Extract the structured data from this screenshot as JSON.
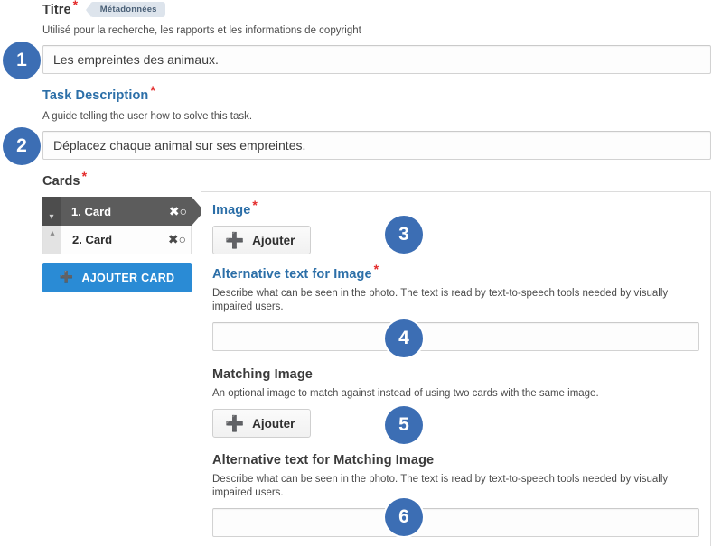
{
  "form": {
    "title_field": {
      "label": "Titre",
      "required_marker": "*",
      "metadata_tag": "Métadonnées",
      "helper": "Utilisé pour la recherche, les rapports et les informations de copyright",
      "value": "Les empreintes des animaux.",
      "placeholder": ""
    },
    "task_description_field": {
      "label": "Task Description",
      "required_marker": "*",
      "helper": "A guide telling the user how to solve this task.",
      "value": "Déplacez chaque animal sur ses empreintes.",
      "placeholder": ""
    },
    "cards_section": {
      "label": "Cards",
      "required_marker": "*",
      "items": [
        {
          "title": "1. Card",
          "remove_icon": "close-circle-icon",
          "handle_icon": "chevron-down-icon",
          "active": true
        },
        {
          "title": "2. Card",
          "remove_icon": "close-circle-icon",
          "handle_icon": "chevron-up-icon",
          "active": false
        }
      ],
      "add_button_label": "AJOUTER CARD",
      "add_button_icon": "plus-icon"
    },
    "card_editor": {
      "image": {
        "label": "Image",
        "required_marker": "*",
        "add_button_label": "Ajouter",
        "add_button_icon": "plus-icon"
      },
      "image_alt": {
        "label": "Alternative text for Image",
        "required_marker": "*",
        "helper": "Describe what can be seen in the photo. The text is read by text-to-speech tools needed by visually impaired users.",
        "value": "",
        "placeholder": ""
      },
      "matching_image": {
        "label": "Matching Image",
        "helper": "An optional image to match against instead of using two cards with the same image.",
        "add_button_label": "Ajouter",
        "add_button_icon": "plus-icon"
      },
      "matching_image_alt": {
        "label": "Alternative text for Matching Image",
        "helper": "Describe what can be seen in the photo. The text is read by text-to-speech tools needed by visually impaired users.",
        "value": "",
        "placeholder": ""
      }
    }
  },
  "callouts": [
    {
      "number": "1"
    },
    {
      "number": "2"
    },
    {
      "number": "3"
    },
    {
      "number": "4"
    },
    {
      "number": "5"
    },
    {
      "number": "6"
    }
  ],
  "colors": {
    "callout_blue": "#3c6eb4",
    "heading_blue": "#2c6fa8",
    "required_red": "#e32b2b",
    "primary_button_blue": "#2a8bd5",
    "active_card_gray": "#5c5c5c",
    "plus_green": "#3fbf3f"
  }
}
